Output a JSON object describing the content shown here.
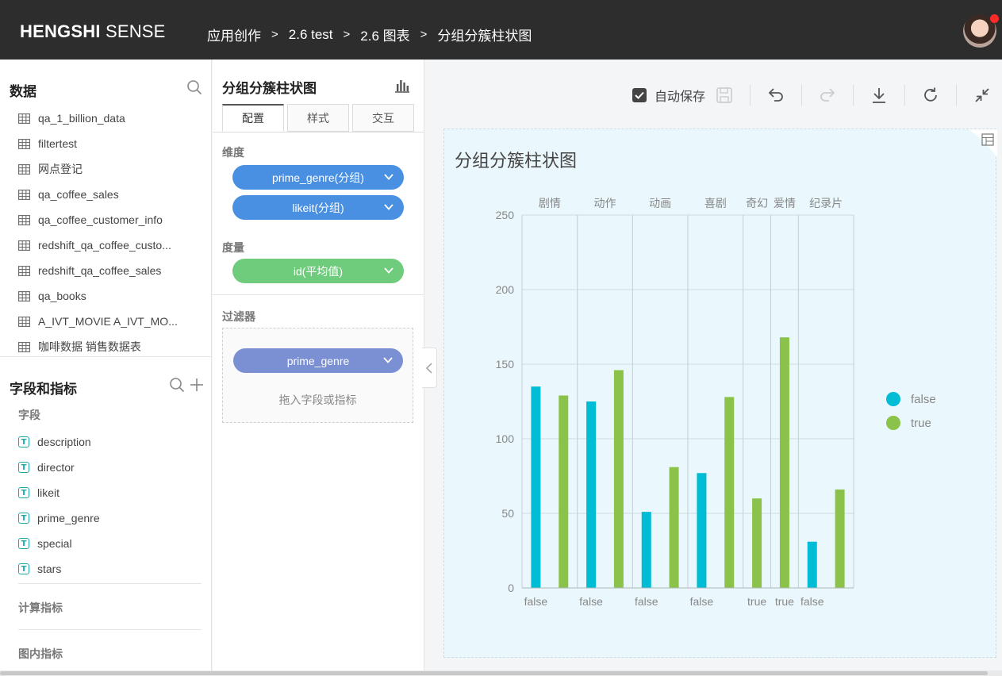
{
  "header": {
    "brand_bold": "HENGSHI",
    "brand_light": " SENSE",
    "breadcrumbs": [
      "应用创作",
      "2.6 test",
      "2.6 图表",
      "分组分簇柱状图"
    ],
    "separator": ">"
  },
  "data_panel": {
    "title": "数据",
    "datasets": [
      "qa_1_billion_data",
      "filtertest",
      "网点登记",
      "qa_coffee_sales",
      "qa_coffee_customer_info",
      "redshift_qa_coffee_custo...",
      "redshift_qa_coffee_sales",
      "qa_books",
      "A_IVT_MOVIE A_IVT_MO...",
      "咖啡数据 销售数据表"
    ]
  },
  "fields_panel": {
    "title": "字段和指标",
    "fields_label": "字段",
    "fields": [
      "description",
      "director",
      "likeit",
      "prime_genre",
      "special",
      "stars"
    ],
    "field_type_glyph": "T",
    "calc_metrics_label": "计算指标",
    "chart_metrics_label": "图内指标"
  },
  "config": {
    "chart_name": "分组分簇柱状图",
    "tabs": [
      "配置",
      "样式",
      "交互"
    ],
    "dimension_label": "维度",
    "dimensions": [
      "prime_genre(分组)",
      "likeit(分组)"
    ],
    "measure_label": "度量",
    "measures": [
      "id(平均值)"
    ],
    "filter_label": "过滤器",
    "filters": [
      "prime_genre"
    ],
    "drop_hint": "拖入字段或指标"
  },
  "toolbar": {
    "autosave_label": "自动保存",
    "autosave_checked": true
  },
  "colors": {
    "false": "#00bcd4",
    "true": "#8bc34a",
    "dimension_pill": "#4a90e2",
    "measure_pill": "#6fcc7d",
    "filter_pill": "#7b8fd3"
  },
  "chart_data": {
    "type": "bar",
    "title": "分组分簇柱状图",
    "groups": [
      "剧情",
      "动作",
      "动画",
      "喜剧",
      "奇幻",
      "爱情",
      "纪录片"
    ],
    "group_bars": [
      [
        {
          "key": "false",
          "value": 135
        },
        {
          "key": "true",
          "value": 129
        }
      ],
      [
        {
          "key": "false",
          "value": 125
        },
        {
          "key": "true",
          "value": 146
        }
      ],
      [
        {
          "key": "false",
          "value": 51
        },
        {
          "key": "true",
          "value": 81
        }
      ],
      [
        {
          "key": "false",
          "value": 77
        },
        {
          "key": "true",
          "value": 128
        }
      ],
      [
        {
          "key": "true",
          "value": 60
        }
      ],
      [
        {
          "key": "true",
          "value": 168
        }
      ],
      [
        {
          "key": "false",
          "value": 31
        },
        {
          "key": "true",
          "value": 66
        }
      ]
    ],
    "x_tick_labels": [
      "false",
      "false",
      "false",
      "false",
      "true",
      "true",
      "false"
    ],
    "yticks": [
      0,
      50,
      100,
      150,
      200,
      250
    ],
    "ylim": [
      0,
      250
    ],
    "legend": [
      "false",
      "true"
    ],
    "legend_position": "right",
    "grid": true
  }
}
